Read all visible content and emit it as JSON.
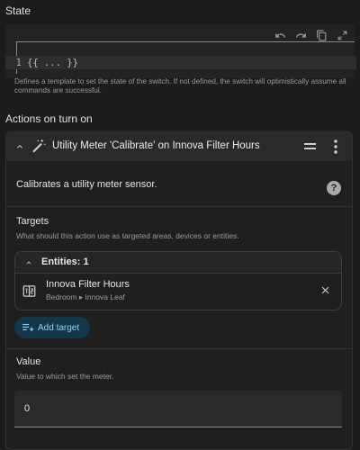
{
  "state_section": {
    "title": "State",
    "line_number": "1",
    "code": "{{ ... }}",
    "helper": "Defines a template to set the state of the switch. If not defined, the switch will optimistically assume all commands are successful."
  },
  "actions_section": {
    "title": "Actions on turn on"
  },
  "card": {
    "title": "Utility Meter 'Calibrate' on Innova Filter Hours",
    "description": "Calibrates a utility meter sensor.",
    "help": "?",
    "targets": {
      "label": "Targets",
      "sublabel": "What should this action use as targeted areas, devices or entities.",
      "entities_header": "Entities: 1",
      "entity_name": "Innova Filter Hours",
      "entity_location": "Bedroom ▸ Innova Leaf",
      "add_target_label": "Add target"
    },
    "value": {
      "label": "Value",
      "sublabel": "Value to which set the meter.",
      "input_value": "0"
    }
  },
  "colors": {
    "background": "#1c1c1c",
    "card_header": "#2a2a2a",
    "accent": "#8fd0f2",
    "add_target_bg": "#143648"
  }
}
